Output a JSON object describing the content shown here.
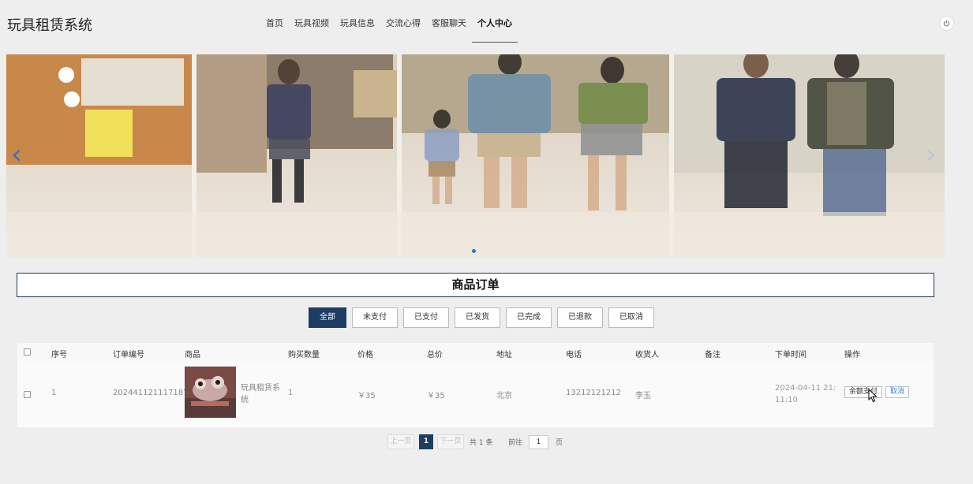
{
  "header": {
    "title": "玩具租赁系统",
    "nav": [
      {
        "label": "首页"
      },
      {
        "label": "玩具视频"
      },
      {
        "label": "玩具信息"
      },
      {
        "label": "交流心得"
      },
      {
        "label": "客服聊天"
      },
      {
        "label": "个人中心"
      }
    ],
    "active_nav": "个人中心",
    "power_icon": "power-icon"
  },
  "banner": {
    "prev_arrow": "‹",
    "next_arrow": "›",
    "dot_count": 1,
    "active_dot": 0
  },
  "section": {
    "title": "商品订单"
  },
  "filters": [
    {
      "label": "全部"
    },
    {
      "label": "未支付"
    },
    {
      "label": "已支付"
    },
    {
      "label": "已发货"
    },
    {
      "label": "已完成"
    },
    {
      "label": "已退款"
    },
    {
      "label": "已取消"
    }
  ],
  "active_filter": "全部",
  "table": {
    "columns": [
      "序号",
      "订单编号",
      "商品",
      "购买数量",
      "价格",
      "总价",
      "地址",
      "电话",
      "收货人",
      "备注",
      "下单时间",
      "操作"
    ],
    "rows": [
      {
        "index": "1",
        "order_no": "202441121117187",
        "product": "玩具租赁系统",
        "quantity": "1",
        "price": "￥35",
        "total": "￥35",
        "address": "北京",
        "phone": "13212121212",
        "receiver": "李玉",
        "remark": "",
        "time": "2024-04-11 21:11:10",
        "actions": {
          "pay": "余额支付",
          "cancel": "取消"
        }
      }
    ]
  },
  "pagination": {
    "prev": "上一页",
    "current": "1",
    "next": "下一页",
    "total_text": "共 1 条",
    "goto_label": "前往",
    "goto_value": "1",
    "page_unit": "页"
  },
  "colors": {
    "primary": "#1d3e62",
    "accent_blue": "#2a74d4",
    "background": "#eeeeee"
  }
}
